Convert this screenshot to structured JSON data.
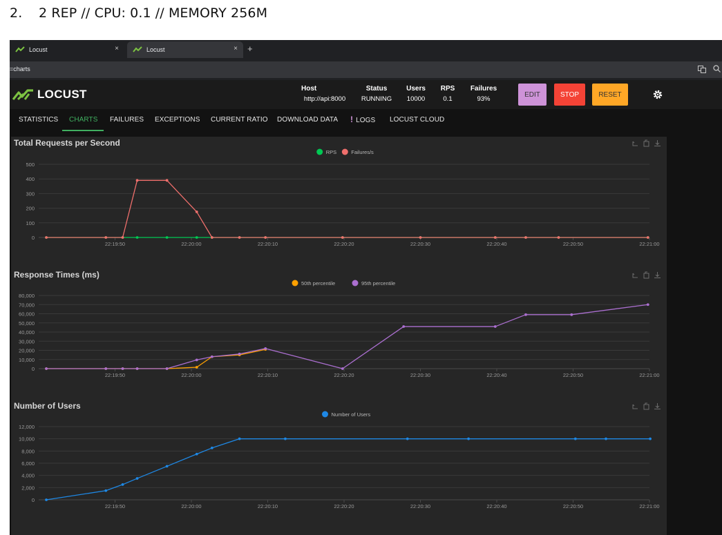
{
  "heading": {
    "number": "2.",
    "text": "2 REP // CPU: 0.1 // MEMORY 256M"
  },
  "browser": {
    "tabs": [
      {
        "title": "Locust"
      },
      {
        "title": "Locust"
      }
    ],
    "new_tab": "+",
    "close": "×",
    "url": "=charts"
  },
  "header": {
    "logo_text": "LOCUST",
    "host": {
      "label": "Host",
      "value": "http://api:8000"
    },
    "status": {
      "label": "Status",
      "value": "RUNNING"
    },
    "users": {
      "label": "Users",
      "value": "10000"
    },
    "rps": {
      "label": "RPS",
      "value": "0.1"
    },
    "failures": {
      "label": "Failures",
      "value": "93%"
    },
    "edit_label": "EDIT",
    "stop_label": "STOP",
    "reset_label": "RESET",
    "colors": {
      "edit": "#ce93d8",
      "stop": "#f44336",
      "reset": "#ffa726",
      "accent": "#40b060"
    }
  },
  "nav": {
    "tabs": [
      "STATISTICS",
      "CHARTS",
      "FAILURES",
      "EXCEPTIONS",
      "CURRENT RATIO",
      "DOWNLOAD DATA",
      "LOGS",
      "LOCUST CLOUD"
    ],
    "active": "CHARTS"
  },
  "chart_data": [
    {
      "type": "line",
      "title": "Total Requests per Second",
      "ylim": [
        0,
        500
      ],
      "yticks": [
        0,
        100,
        200,
        300,
        400,
        500
      ],
      "ytick_labels": [
        "0",
        "100",
        "200",
        "300",
        "400",
        "500"
      ],
      "xlim": [
        -10,
        70
      ],
      "xticks": [
        0,
        10,
        20,
        30,
        40,
        50,
        60,
        70
      ],
      "xtick_labels": [
        "22:19:50",
        "22:20:00",
        "22:20:10",
        "22:20:20",
        "22:20:30",
        "22:20:40",
        "22:20:50",
        "22:21:00"
      ],
      "grid": true,
      "legend": "top-center",
      "series": [
        {
          "name": "RPS",
          "color": "#00c853",
          "x": [
            -9,
            -1.2,
            1,
            2.9,
            6.8,
            10.7,
            12.7,
            16.3,
            19.7,
            29.8,
            40,
            49.8,
            53.8,
            58.1,
            69.8
          ],
          "y": [
            0,
            0,
            0,
            0,
            0,
            0,
            0,
            0,
            0,
            0,
            0,
            0,
            0,
            0,
            0
          ]
        },
        {
          "name": "Failures/s",
          "color": "#ef6f6c",
          "x": [
            -9,
            -1.2,
            1,
            2.9,
            6.8,
            10.7,
            12.7,
            16.3,
            19.7,
            29.8,
            40,
            49.8,
            53.8,
            58.1,
            69.8
          ],
          "y": [
            0,
            0,
            0,
            390,
            390,
            175,
            0,
            0,
            0,
            0,
            0,
            0,
            0,
            0,
            0
          ]
        }
      ]
    },
    {
      "type": "line",
      "title": "Response Times (ms)",
      "ylim": [
        0,
        80000
      ],
      "yticks": [
        0,
        10000,
        20000,
        30000,
        40000,
        50000,
        60000,
        70000,
        80000
      ],
      "ytick_labels": [
        "0",
        "10,000",
        "20,000",
        "30,000",
        "40,000",
        "50,000",
        "60,000",
        "70,000",
        "80,000"
      ],
      "xlim": [
        -10,
        70
      ],
      "xticks": [
        0,
        10,
        20,
        30,
        40,
        50,
        60,
        70
      ],
      "xtick_labels": [
        "22:19:50",
        "22:20:00",
        "22:20:10",
        "22:20:20",
        "22:20:30",
        "22:20:40",
        "22:20:50",
        "22:21:00"
      ],
      "grid": true,
      "legend": "top-center",
      "series": [
        {
          "name": "50th percentile",
          "color": "#ffa000",
          "x": [
            -9,
            -1.2,
            1,
            2.9,
            6.8,
            10.7,
            12.7,
            16.3,
            19.7
          ],
          "y": [
            0,
            0,
            0,
            0,
            0,
            1500,
            13000,
            15000,
            21000
          ]
        },
        {
          "name": "95th percentile",
          "color": "#ab6fd0",
          "x": [
            -9,
            -1.2,
            1,
            2.9,
            6.8,
            10.7,
            12.7,
            16.3,
            19.7,
            29.8,
            37.8,
            49.8,
            53.8,
            59.8,
            69.8
          ],
          "y": [
            0,
            0,
            0,
            0,
            0,
            9500,
            13000,
            16000,
            22000,
            0,
            46000,
            46000,
            59000,
            59000,
            70000
          ]
        }
      ]
    },
    {
      "type": "line",
      "title": "Number of Users",
      "ylim": [
        0,
        12000
      ],
      "yticks": [
        0,
        2000,
        4000,
        6000,
        8000,
        10000,
        12000
      ],
      "ytick_labels": [
        "0",
        "2,000",
        "4,000",
        "6,000",
        "8,000",
        "10,000",
        "12,000"
      ],
      "xlim": [
        -10,
        70
      ],
      "xticks": [
        0,
        10,
        20,
        30,
        40,
        50,
        60,
        70
      ],
      "xtick_labels": [
        "22:19:50",
        "22:20:00",
        "22:20:10",
        "22:20:20",
        "22:20:30",
        "22:20:40",
        "22:20:50",
        "22:21:00"
      ],
      "grid": true,
      "legend": "top-center",
      "series": [
        {
          "name": "Number of Users",
          "color": "#1e88e5",
          "x": [
            -9,
            -1.2,
            1,
            2.9,
            6.8,
            10.7,
            12.7,
            16.3,
            22.3,
            38.3,
            46.3,
            60.3,
            64.3,
            70.1
          ],
          "y": [
            0,
            1500,
            2500,
            3500,
            5500,
            7500,
            8500,
            10000,
            10000,
            10000,
            10000,
            10000,
            10000,
            10000
          ]
        }
      ]
    }
  ]
}
